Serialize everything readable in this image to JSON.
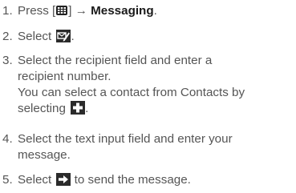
{
  "steps": [
    {
      "number": "1.",
      "text_before": "Press [",
      "key_icon": "menu-grid-icon",
      "text_after_key": "] → ",
      "bold_text": "Messaging",
      "text_end": "."
    },
    {
      "number": "2.",
      "text_before": "Select ",
      "icon": "compose-message-icon",
      "text_end": "."
    },
    {
      "number": "3.",
      "line1": "Select the recipient field and enter a",
      "line2": "recipient number.",
      "line3": "You can select a contact from Contacts by",
      "line4_before": "selecting ",
      "icon": "add-contact-icon",
      "text_end": "."
    },
    {
      "number": "4.",
      "line1": "Select the text input field and enter your",
      "line2": "message."
    },
    {
      "number": "5.",
      "text_before": "Select ",
      "icon": "send-arrow-icon",
      "text_end": " to send the message."
    }
  ],
  "colors": {
    "text": "#555555",
    "bold": "#1a1a1a",
    "icon_bg": "#2b2b2b"
  }
}
